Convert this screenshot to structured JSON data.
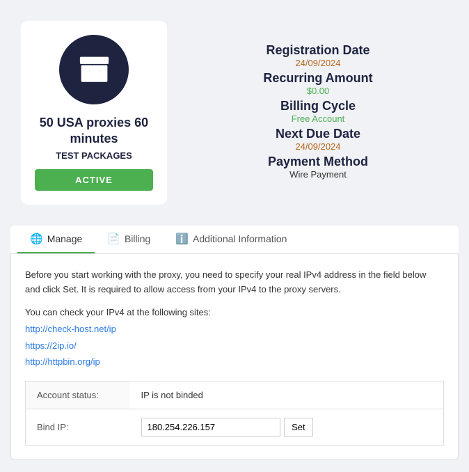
{
  "card": {
    "product_name": "50 USA proxies 60 minutes",
    "product_tag": "TEST PACKAGES",
    "status": "ACTIVE",
    "registration_date_label": "Registration Date",
    "registration_date_value": "24/09/2024",
    "recurring_amount_label": "Recurring Amount",
    "recurring_amount_value": "$0.00",
    "billing_cycle_label": "Billing Cycle",
    "billing_cycle_value": "Free Account",
    "next_due_date_label": "Next Due Date",
    "next_due_date_value": "24/09/2024",
    "payment_method_label": "Payment Method",
    "payment_method_value": "Wire Payment"
  },
  "tabs": [
    {
      "id": "manage",
      "label": "Manage",
      "icon": "🌐",
      "active": true
    },
    {
      "id": "billing",
      "label": "Billing",
      "icon": "📄",
      "active": false
    },
    {
      "id": "additional-info",
      "label": "Additional Information",
      "icon": "ℹ️",
      "active": false
    }
  ],
  "manage_tab": {
    "intro_line1": "Before you start working with the proxy, you need to specify your real IPv4 address in the field below",
    "intro_line2": "and click Set. It is required to allow access from your IPv4 to the proxy servers.",
    "check_text": "You can check your IPv4 at the following sites:",
    "links": [
      "http://check-host.net/ip",
      "https://2ip.io/",
      "http://httpbin.org/ip"
    ],
    "account_status_label": "Account status:",
    "account_status_value": "IP is not binded",
    "bind_ip_label": "Bind IP:",
    "bind_ip_value": "180.254.226.157",
    "set_button_label": "Set"
  }
}
